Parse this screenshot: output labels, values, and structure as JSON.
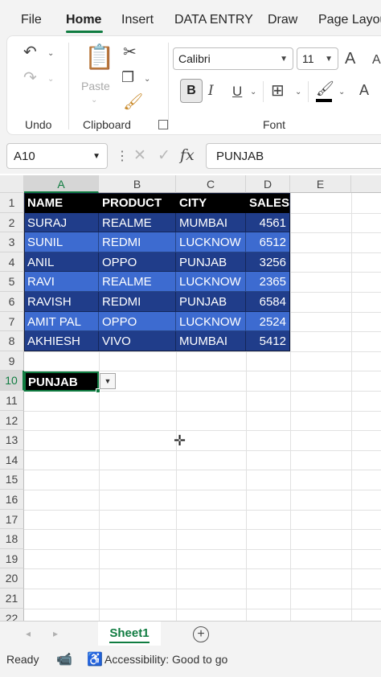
{
  "menu": {
    "tabs": [
      {
        "label": "File"
      },
      {
        "label": "Home"
      },
      {
        "label": "Insert"
      },
      {
        "label": "DATA ENTRY"
      },
      {
        "label": "Draw"
      },
      {
        "label": "Page Layou"
      }
    ],
    "active": "Home"
  },
  "ribbon": {
    "undo": {
      "label": "Undo",
      "icons": [
        "undo-icon",
        "redo-icon"
      ]
    },
    "clipboard": {
      "label": "Clipboard",
      "paste_label": "Paste",
      "icons": [
        "paste-icon",
        "cut-icon",
        "copy-icon",
        "format-painter-icon"
      ]
    },
    "font": {
      "label": "Font",
      "font_name": "Calibri",
      "font_size": "11",
      "bold": "B",
      "italic": "I",
      "underline": "U",
      "grow": "A",
      "shrink": "A",
      "color_letter": "A"
    }
  },
  "formula_bar": {
    "name_box": "A10",
    "fx": "fx",
    "value": "PUNJAB"
  },
  "sheet": {
    "columns": [
      "A",
      "B",
      "C",
      "D",
      "E"
    ],
    "rows": [
      "1",
      "2",
      "3",
      "4",
      "5",
      "6",
      "7",
      "8",
      "9",
      "10",
      "11",
      "12",
      "13",
      "14",
      "15",
      "16",
      "17",
      "18",
      "19",
      "20",
      "21",
      "22"
    ],
    "table": {
      "headers": [
        "NAME",
        "PRODUCT",
        "CITY",
        "SALES"
      ],
      "rows": [
        [
          "SURAJ",
          "REALME",
          "MUMBAI",
          "4561"
        ],
        [
          "SUNIL",
          "REDMI",
          "LUCKNOW",
          "6512"
        ],
        [
          "ANIL",
          "OPPO",
          "PUNJAB",
          "3256"
        ],
        [
          "RAVI",
          "REALME",
          "LUCKNOW",
          "2365"
        ],
        [
          "RAVISH",
          "REDMI",
          "PUNJAB",
          "6584"
        ],
        [
          "AMIT PAL",
          "OPPO",
          "LUCKNOW",
          "2524"
        ],
        [
          "AKHIESH",
          "VIVO",
          "MUMBAI",
          "5412"
        ]
      ]
    },
    "active_cell_value": "PUNJAB",
    "colors": {
      "header_bg": "#000000",
      "dark_row": "#203d8a",
      "light_row": "#3d6bd0",
      "accent": "#107c41"
    }
  },
  "sheet_tabs": [
    {
      "label": "Sheet1"
    }
  ],
  "status": {
    "ready": "Ready",
    "accessibility": "Accessibility: Good to go"
  }
}
